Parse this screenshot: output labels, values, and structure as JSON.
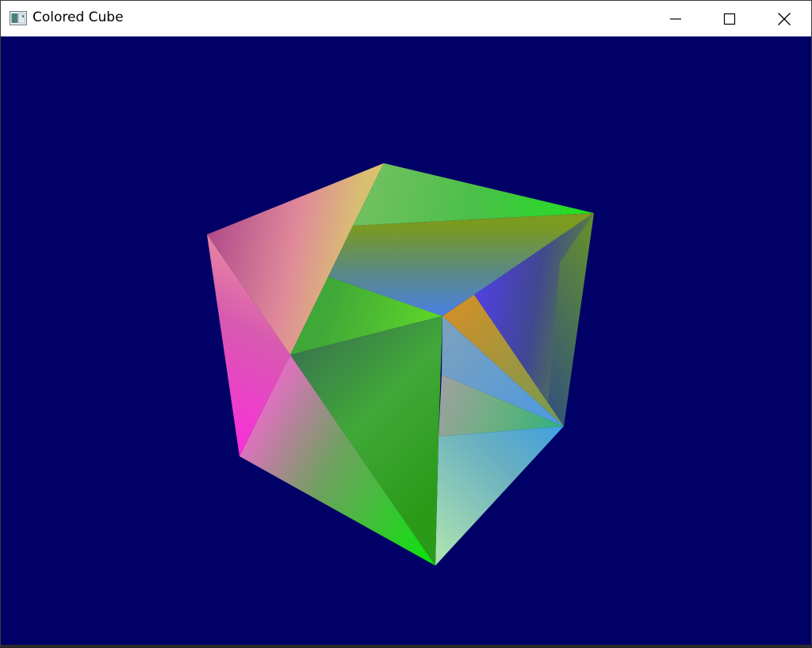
{
  "window": {
    "title": "Colored Cube",
    "icon": "window-app-icon",
    "controls": {
      "minimize_icon": "minimize-icon",
      "maximize_icon": "maximize-icon",
      "close_icon": "close-icon"
    }
  },
  "scene": {
    "background_color": "#000066",
    "object": "colored-cube"
  }
}
